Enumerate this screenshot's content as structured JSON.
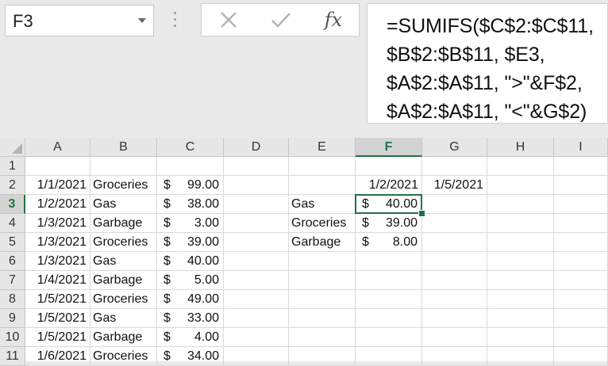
{
  "name_box": {
    "value": "F3",
    "dropdown_icon": "chevron-down-icon"
  },
  "formula_bar": {
    "cancel_icon": "close-icon",
    "enter_icon": "check-icon",
    "fx_label": "fx",
    "lines": [
      "=SUMIFS($C$2:$C$11,",
      "$B$2:$B$11, $E3,",
      "$A$2:$A$11, \">\"&F$2,",
      "$A$2:$A$11, \"<\"&G$2)"
    ]
  },
  "colors": {
    "accent": "#217346",
    "header_bg": "#e6e6e6",
    "grid_line": "#d9d9d9"
  },
  "sheet": {
    "columns": [
      "A",
      "B",
      "C",
      "D",
      "E",
      "F",
      "G",
      "H",
      "I"
    ],
    "rows": [
      "1",
      "2",
      "3",
      "4",
      "5",
      "6",
      "7",
      "8",
      "9",
      "10",
      "11"
    ],
    "selected_column": "F",
    "selected_row": "3",
    "data": [
      {
        "a": "",
        "b": "",
        "c_cur": "",
        "c_amt": "",
        "e": "",
        "f_cur": "",
        "f_amt": "",
        "f_date": "",
        "g": ""
      },
      {
        "a": "1/1/2021",
        "b": "Groceries",
        "c_cur": "$",
        "c_amt": "99.00",
        "e": "",
        "f_cur": "",
        "f_amt": "",
        "f_date": "1/2/2021",
        "g": "1/5/2021"
      },
      {
        "a": "1/2/2021",
        "b": "Gas",
        "c_cur": "$",
        "c_amt": "38.00",
        "e": "Gas",
        "f_cur": "$",
        "f_amt": "40.00",
        "f_date": "",
        "g": ""
      },
      {
        "a": "1/3/2021",
        "b": "Garbage",
        "c_cur": "$",
        "c_amt": "3.00",
        "e": "Groceries",
        "f_cur": "$",
        "f_amt": "39.00",
        "f_date": "",
        "g": ""
      },
      {
        "a": "1/3/2021",
        "b": "Groceries",
        "c_cur": "$",
        "c_amt": "39.00",
        "e": "Garbage",
        "f_cur": "$",
        "f_amt": "8.00",
        "f_date": "",
        "g": ""
      },
      {
        "a": "1/3/2021",
        "b": "Gas",
        "c_cur": "$",
        "c_amt": "40.00",
        "e": "",
        "f_cur": "",
        "f_amt": "",
        "f_date": "",
        "g": ""
      },
      {
        "a": "1/4/2021",
        "b": "Garbage",
        "c_cur": "$",
        "c_amt": "5.00",
        "e": "",
        "f_cur": "",
        "f_amt": "",
        "f_date": "",
        "g": ""
      },
      {
        "a": "1/5/2021",
        "b": "Groceries",
        "c_cur": "$",
        "c_amt": "49.00",
        "e": "",
        "f_cur": "",
        "f_amt": "",
        "f_date": "",
        "g": ""
      },
      {
        "a": "1/5/2021",
        "b": "Gas",
        "c_cur": "$",
        "c_amt": "33.00",
        "e": "",
        "f_cur": "",
        "f_amt": "",
        "f_date": "",
        "g": ""
      },
      {
        "a": "1/5/2021",
        "b": "Garbage",
        "c_cur": "$",
        "c_amt": "4.00",
        "e": "",
        "f_cur": "",
        "f_amt": "",
        "f_date": "",
        "g": ""
      },
      {
        "a": "1/6/2021",
        "b": "Groceries",
        "c_cur": "$",
        "c_amt": "34.00",
        "e": "",
        "f_cur": "",
        "f_amt": "",
        "f_date": "",
        "g": ""
      }
    ]
  }
}
